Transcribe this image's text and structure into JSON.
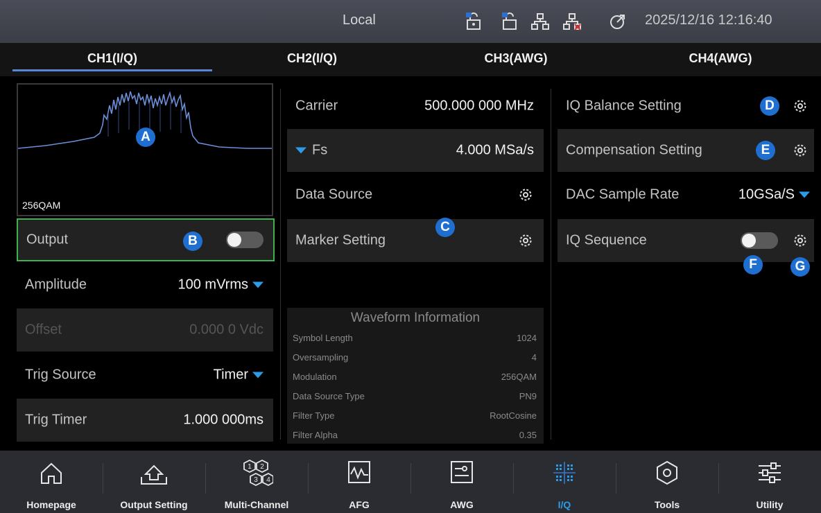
{
  "status": {
    "title": "Local",
    "datetime": "2025/12/16 12:16:40"
  },
  "tabs": [
    {
      "label": "CH1(I/Q)",
      "active": true
    },
    {
      "label": "CH2(I/Q)"
    },
    {
      "label": "CH3(AWG)"
    },
    {
      "label": "CH4(AWG)"
    }
  ],
  "preview": {
    "label": "256QAM"
  },
  "left": {
    "output": {
      "label": "Output"
    },
    "amplitude": {
      "label": "Amplitude",
      "value": "100 mVrms"
    },
    "offset": {
      "label": "Offset",
      "value": "0.000 0  Vdc"
    },
    "trig_source": {
      "label": "Trig Source",
      "value": "Timer"
    },
    "trig_timer": {
      "label": "Trig Timer",
      "value": "1.000 000ms"
    }
  },
  "middle": {
    "carrier": {
      "label": "Carrier",
      "value": "500.000 000  MHz"
    },
    "fs": {
      "label": "Fs",
      "value": "4.000 MSa/s"
    },
    "data_source": {
      "label": "Data Source"
    },
    "marker_setting": {
      "label": "Marker Setting"
    }
  },
  "right": {
    "iq_balance": {
      "label": "IQ Balance Setting"
    },
    "compensation": {
      "label": "Compensation Setting"
    },
    "dac_rate": {
      "label": "DAC Sample Rate",
      "value": "10GSa/S"
    },
    "iq_sequence": {
      "label": "IQ Sequence"
    }
  },
  "waveform_info": {
    "title": "Waveform Information",
    "rows": [
      {
        "key": "Symbol Length",
        "value": "1024"
      },
      {
        "key": "Oversampling",
        "value": "4"
      },
      {
        "key": "Modulation",
        "value": "256QAM"
      },
      {
        "key": "Data Source Type",
        "value": "PN9"
      },
      {
        "key": "Filter Type",
        "value": "RootCosine"
      },
      {
        "key": "Filter Alpha",
        "value": "0.35"
      }
    ]
  },
  "badges": {
    "a": "A",
    "b": "B",
    "c": "C",
    "d": "D",
    "e": "E",
    "f": "F",
    "g": "G"
  },
  "nav": [
    {
      "label": "Homepage",
      "icon": "home-icon"
    },
    {
      "label": "Output Setting",
      "icon": "output-setting-icon"
    },
    {
      "label": "Multi-Channel",
      "icon": "multi-channel-icon"
    },
    {
      "label": "AFG",
      "icon": "afg-icon"
    },
    {
      "label": "AWG",
      "icon": "awg-icon"
    },
    {
      "label": "I/Q",
      "icon": "iq-icon",
      "active": true
    },
    {
      "label": "Tools",
      "icon": "tools-icon"
    },
    {
      "label": "Utility",
      "icon": "utility-icon"
    }
  ],
  "colors": {
    "accent": "#2e9be6",
    "badge": "#1e6fd0",
    "highlight": "#3cb44b",
    "tab_underline": "#5a86d6"
  }
}
